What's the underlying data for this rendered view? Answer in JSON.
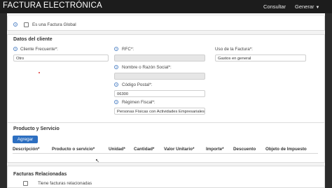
{
  "app": {
    "title": "FACTURA ELECTRÓNICA"
  },
  "nav": {
    "consultar": "Consultar",
    "generar": "Generar"
  },
  "global_invoice": {
    "label": "Es una Factura Global"
  },
  "cliente": {
    "title": "Datos del cliente",
    "cliente_frecuente": {
      "label": "Cliente Frecuente*:",
      "value": "Otro"
    },
    "rfc": {
      "label": "RFC*:",
      "value": ""
    },
    "uso_factura": {
      "label": "Uso de la Factura*:",
      "value": "Gastos en general"
    },
    "nombre": {
      "label": "Nombre o Razón Social*:",
      "value": ""
    },
    "codigo_postal": {
      "label": "Código Postal*:",
      "value": "06300"
    },
    "regimen": {
      "label": "Régimen Fiscal*:",
      "value": "Personas Físicas con Actividades Empresariales"
    }
  },
  "productos": {
    "title": "Producto y Servicio",
    "add_label": "Agregar",
    "columns": [
      "Descripción*",
      "Producto o servicio*",
      "Unidad*",
      "Cantidad*",
      "Valor Unitario*",
      "Importe*",
      "Descuento",
      "Objeto de Impuesto"
    ]
  },
  "relacionadas": {
    "title": "Facturas Relacionadas",
    "checkbox_label": "Tiene facturas relacionadas"
  },
  "colors": {
    "primary": "#2d6fc1",
    "navbar": "#1c1c1c",
    "help_icon": "#5a8ac9"
  }
}
